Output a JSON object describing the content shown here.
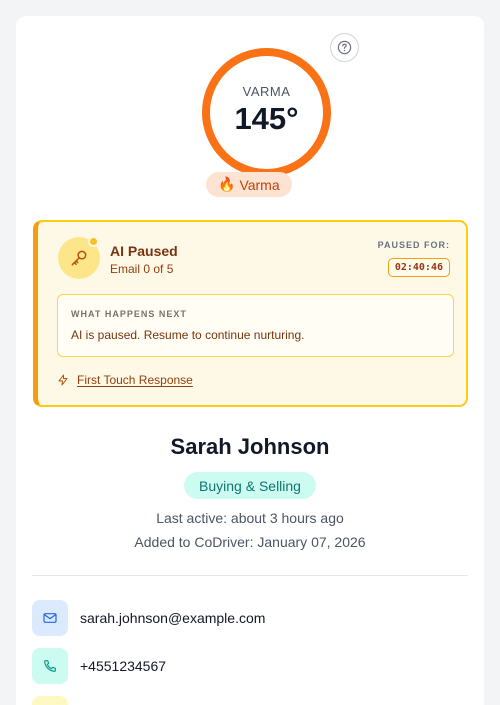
{
  "gauge": {
    "label": "VARMA",
    "value": "145°"
  },
  "temperature_badge": {
    "emoji": "🔥",
    "label": "Varma"
  },
  "ai_status": {
    "title": "AI Paused",
    "subtitle": "Email 0 of 5",
    "paused_for_label": "PAUSED FOR:",
    "timer": "02:40:46",
    "next_label": "WHAT HAPPENS NEXT",
    "next_text": "AI is paused. Resume to continue nurturing.",
    "link_label": "First Touch Response"
  },
  "contact": {
    "name": "Sarah Johnson",
    "tag": "Buying & Selling",
    "last_active": "Last active: about 3 hours ago",
    "added": "Added to CoDriver: January 07, 2026",
    "email": "sarah.johnson@example.com",
    "phone": "+4551234567"
  },
  "colors": {
    "accent": "#f97316",
    "paused_border": "#facc15",
    "tag_bg": "#ccfbf1",
    "tag_text": "#0f766e"
  },
  "icons": [
    "help-icon",
    "key-icon",
    "bolt-icon",
    "mail-icon",
    "phone-icon"
  ]
}
